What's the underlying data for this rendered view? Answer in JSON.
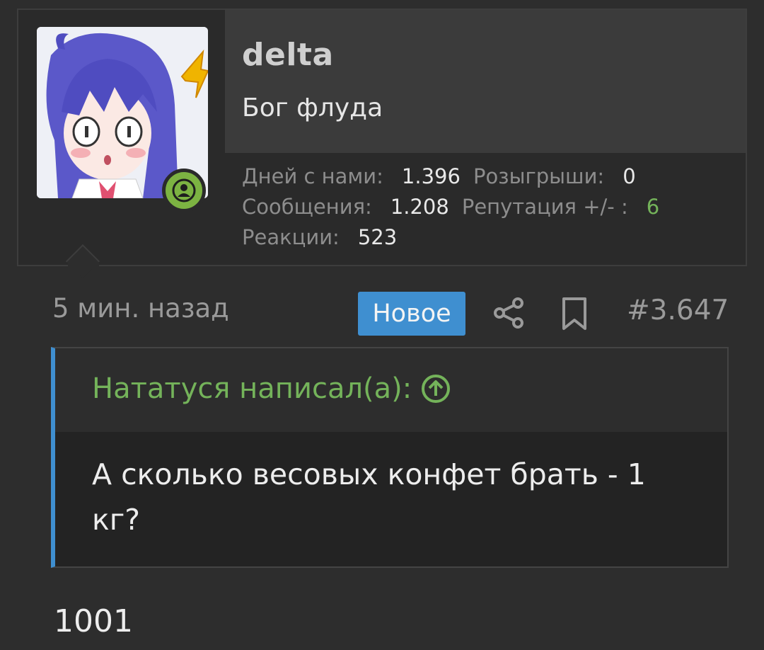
{
  "user": {
    "name": "delta",
    "title": "Бог флуда",
    "online_status": "online",
    "stats": {
      "days_label": "Дней с нами:",
      "days_value": "1.396",
      "giveaways_label": "Розыгрыши:",
      "giveaways_value": "0",
      "messages_label": "Сообщения:",
      "messages_value": "1.208",
      "reputation_label": "Репутация +/- :",
      "reputation_value": "6",
      "reactions_label": "Реакции:",
      "reactions_value": "523"
    }
  },
  "post": {
    "time": "5 мин. назад",
    "new_badge": "Новое",
    "number": "#3.647",
    "quote": {
      "author": "Нататуся написал(а):",
      "text": "А сколько весовых конфет брать - 1 кг?"
    },
    "body": "1001"
  },
  "colors": {
    "background": "#2d2d2d",
    "accent_blue": "#3f8fd0",
    "accent_green": "#74b35a",
    "online_green": "#7cb342"
  },
  "icons": [
    "user-icon",
    "share-icon",
    "bookmark-icon",
    "arrow-up-circle-icon"
  ]
}
